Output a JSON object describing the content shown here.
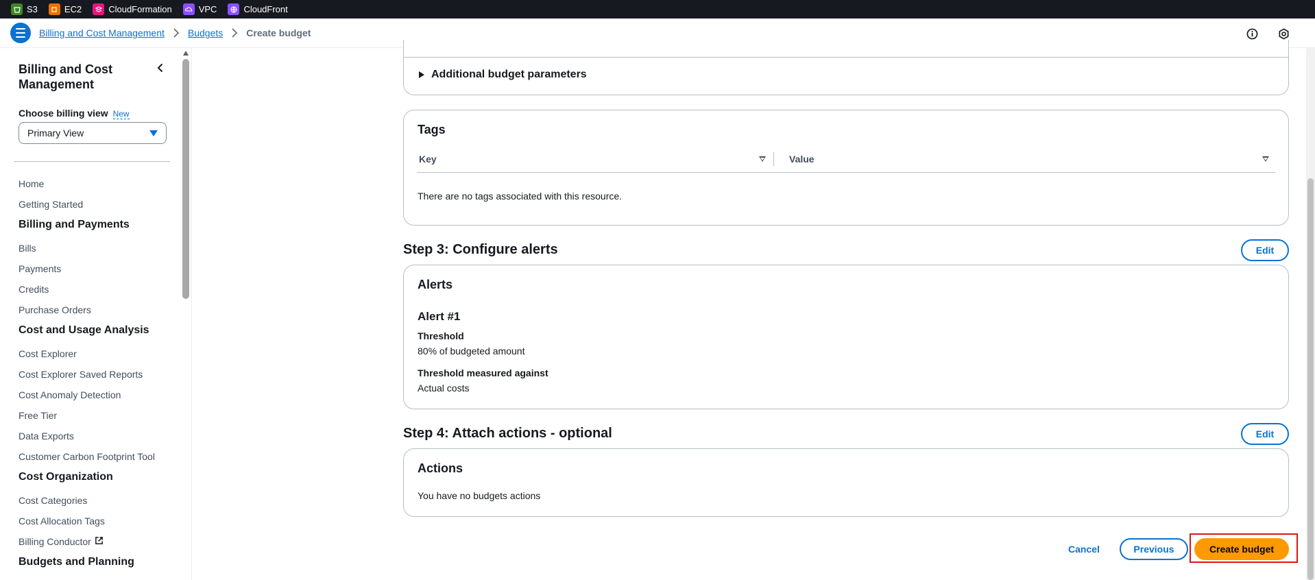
{
  "topbar": {
    "services": [
      {
        "label": "S3",
        "color": "#3f8624",
        "icon": "bucket-icon"
      },
      {
        "label": "EC2",
        "color": "#ed7100",
        "icon": "chip-icon"
      },
      {
        "label": "CloudFormation",
        "color": "#e7157b",
        "icon": "stack-icon"
      },
      {
        "label": "VPC",
        "color": "#8c4fff",
        "icon": "cloud-network-icon"
      },
      {
        "label": "CloudFront",
        "color": "#8c4fff",
        "icon": "globe-icon"
      }
    ]
  },
  "breadcrumb": {
    "items": [
      "Billing and Cost Management",
      "Budgets"
    ],
    "current": "Create budget"
  },
  "sidebar": {
    "title": "Billing and Cost Management",
    "billing_view_label": "Choose billing view",
    "new_badge": "New",
    "selected_view": "Primary View",
    "nav": [
      {
        "type": "item",
        "label": "Home"
      },
      {
        "type": "item",
        "label": "Getting Started"
      },
      {
        "type": "section",
        "label": "Billing and Payments"
      },
      {
        "type": "item",
        "label": "Bills"
      },
      {
        "type": "item",
        "label": "Payments"
      },
      {
        "type": "item",
        "label": "Credits"
      },
      {
        "type": "item",
        "label": "Purchase Orders"
      },
      {
        "type": "section",
        "label": "Cost and Usage Analysis"
      },
      {
        "type": "item",
        "label": "Cost Explorer"
      },
      {
        "type": "item",
        "label": "Cost Explorer Saved Reports"
      },
      {
        "type": "item",
        "label": "Cost Anomaly Detection"
      },
      {
        "type": "item",
        "label": "Free Tier"
      },
      {
        "type": "item",
        "label": "Data Exports"
      },
      {
        "type": "item",
        "label": "Customer Carbon Footprint Tool"
      },
      {
        "type": "section",
        "label": "Cost Organization"
      },
      {
        "type": "item",
        "label": "Cost Categories"
      },
      {
        "type": "item",
        "label": "Cost Allocation Tags"
      },
      {
        "type": "item",
        "label": "Billing Conductor",
        "external": true
      },
      {
        "type": "section",
        "label": "Budgets and Planning"
      }
    ]
  },
  "main": {
    "additional_params_label": "Additional budget parameters",
    "tags": {
      "title": "Tags",
      "columns": [
        "Key",
        "Value"
      ],
      "empty_text": "There are no tags associated with this resource."
    },
    "step3": {
      "title": "Step 3: Configure alerts",
      "edit_label": "Edit",
      "card_title": "Alerts",
      "alert_title": "Alert #1",
      "threshold_label": "Threshold",
      "threshold_value": "80% of budgeted amount",
      "measured_label": "Threshold measured against",
      "measured_value": "Actual costs"
    },
    "step4": {
      "title": "Step 4: Attach actions - optional",
      "edit_label": "Edit",
      "card_title": "Actions",
      "empty_text": "You have no budgets actions"
    },
    "footer": {
      "cancel_label": "Cancel",
      "previous_label": "Previous",
      "create_label": "Create budget"
    }
  },
  "colors": {
    "accent": "#0972d3",
    "primary_button": "#ff9900",
    "highlight": "#d91515"
  }
}
